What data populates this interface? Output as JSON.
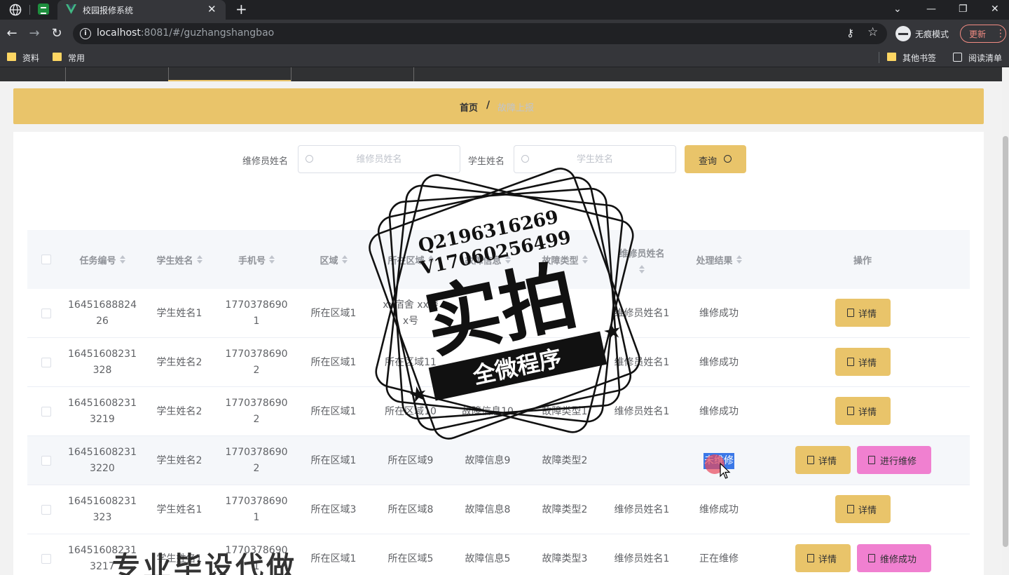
{
  "browser": {
    "tab_title": "校园报修系统",
    "url_host": "localhost",
    "url_rest": ":8081/#/guzhangshangbao",
    "incognito_label": "无痕模式",
    "update_label": "更新",
    "bookmarks": [
      "资料",
      "常用"
    ],
    "other_bookmarks": "其他书签",
    "reading_list": "阅读清单"
  },
  "breadcrumb": {
    "home": "首页",
    "sep": "/",
    "current": "故障上报"
  },
  "search": {
    "repairer_label": "维修员姓名",
    "repairer_placeholder": "维修员姓名",
    "student_label": "学生姓名",
    "student_placeholder": "学生姓名",
    "query_label": "查询"
  },
  "table": {
    "headers": [
      "任务编号",
      "学生姓名",
      "手机号",
      "区域",
      "所在区域",
      "故障信息",
      "故障类型",
      "维修员姓名",
      "处理结果",
      "操作"
    ],
    "detail_label": "详情",
    "rows": [
      {
        "id": [
          "16451688824",
          "26"
        ],
        "student": "学生姓名1",
        "phone": [
          "1770378690",
          "1"
        ],
        "area": "所在区域1",
        "location": [
          "xx宿舍 xx楼",
          "x号"
        ],
        "fault": "",
        "type": "",
        "repairer": "维修员姓名1",
        "result": "维修成功",
        "action": ""
      },
      {
        "id": [
          "16451608231",
          "328"
        ],
        "student": "学生姓名2",
        "phone": [
          "1770378690",
          "2"
        ],
        "area": "所在区域1",
        "location": [
          "所在区域11"
        ],
        "fault": "",
        "type": "",
        "repairer": "维修员姓名1",
        "result": "维修成功",
        "action": ""
      },
      {
        "id": [
          "16451608231",
          "3219"
        ],
        "student": "学生姓名2",
        "phone": [
          "1770378690",
          "2"
        ],
        "area": "所在区域1",
        "location": [
          "所在区域10"
        ],
        "fault": "故障信息10",
        "type": "故障类型1",
        "repairer": "维修员姓名1",
        "result": "维修成功",
        "action": ""
      },
      {
        "id": [
          "16451608231",
          "3220"
        ],
        "student": "学生姓名2",
        "phone": [
          "1770378690",
          "2"
        ],
        "area": "所在区域1",
        "location": [
          "所在区域9"
        ],
        "fault": "故障信息9",
        "type": "故障类型2",
        "repairer": "",
        "result": "未维修",
        "action": "进行维修"
      },
      {
        "id": [
          "16451608231",
          "323"
        ],
        "student": "学生姓名1",
        "phone": [
          "1770378690",
          "1"
        ],
        "area": "所在区域3",
        "location": [
          "所在区域8"
        ],
        "fault": "故障信息8",
        "type": "故障类型2",
        "repairer": "维修员姓名1",
        "result": "维修成功",
        "action": ""
      },
      {
        "id": [
          "16451608231",
          "3217"
        ],
        "student": "学生姓名1",
        "phone": [
          "1770378690",
          "1"
        ],
        "area": "所在区域1",
        "location": [
          "所在区域5"
        ],
        "fault": "故障信息5",
        "type": "故障类型3",
        "repairer": "维修员姓名1",
        "result": "正在维修",
        "action": "维修成功"
      }
    ]
  },
  "watermark": {
    "line1": "Q2196316269",
    "line2": "V17060256499",
    "big": "实拍",
    "ribbon": "全微程序",
    "bottom": "专业毕设代做"
  },
  "colors": {
    "accent": "#e9c46a",
    "action": "#f080d0",
    "selection": "#3b78e7"
  }
}
